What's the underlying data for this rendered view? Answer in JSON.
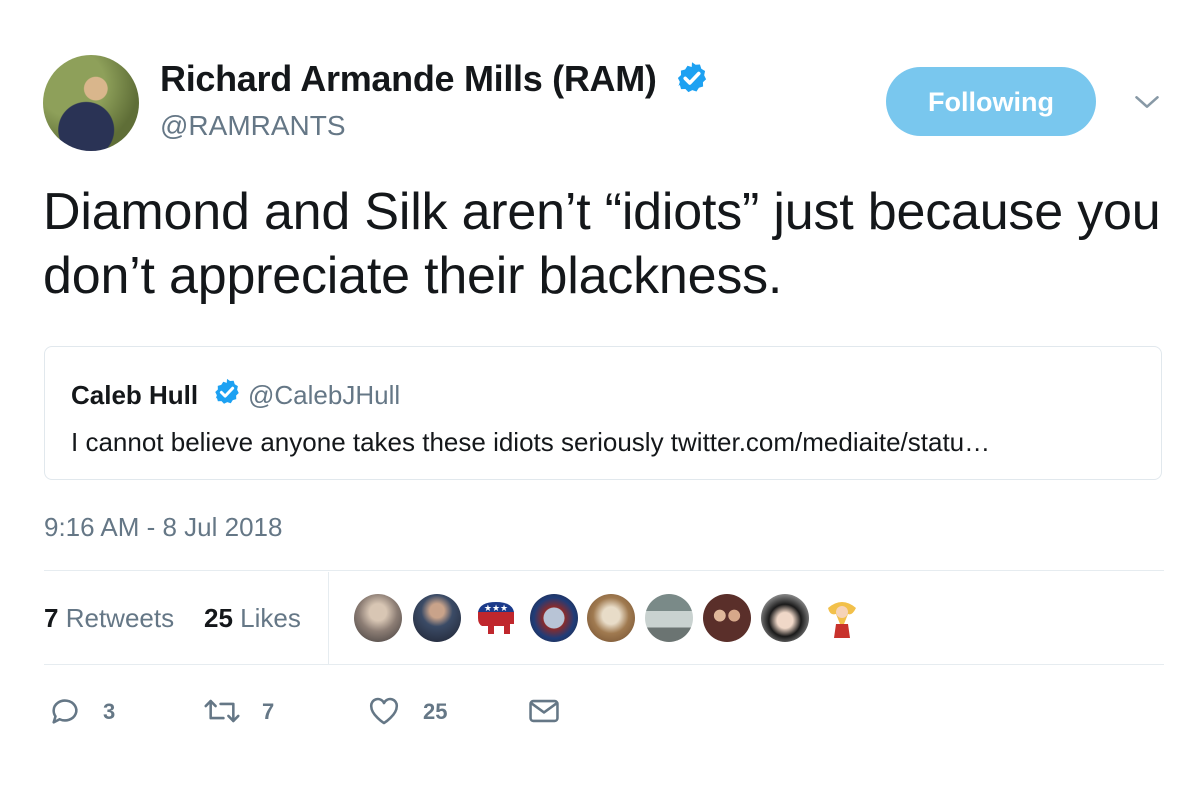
{
  "author": {
    "name": "Richard Armande Mills (RAM)",
    "handle": "@RAMRANTS",
    "follow_label": "Following"
  },
  "tweet": {
    "text": "Diamond and Silk aren’t “idiots” just because you don’t appreciate their blackness.",
    "timestamp": "9:16 AM - 8 Jul 2018"
  },
  "quoted": {
    "name": "Caleb Hull",
    "handle": "@CalebJHull",
    "text": "I cannot believe anyone takes these idiots seriously twitter.com/mediaite/statu…"
  },
  "stats": {
    "retweets_count": "7",
    "retweets_label": "Retweets",
    "likes_count": "25",
    "likes_label": "Likes"
  },
  "actions": {
    "reply_count": "3",
    "retweet_count": "7",
    "like_count": "25"
  },
  "icons": {
    "verified": "verified-badge-icon",
    "chevron": "chevron-down-icon",
    "reply": "reply-icon",
    "retweet": "retweet-icon",
    "like": "heart-icon",
    "dm": "envelope-icon"
  },
  "colors": {
    "accent": "#1da1f2",
    "follow_button": "#79c7ee",
    "muted_text": "#657786",
    "border": "#e1e8ed"
  }
}
